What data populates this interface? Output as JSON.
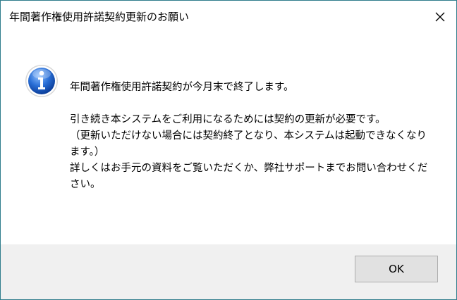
{
  "window": {
    "title": "年間著作権使用許諾契約更新のお願い",
    "icon": "information-icon"
  },
  "message": {
    "line1": "年間著作権使用許諾契約が今月末で終了します。",
    "line2": "引き続き本システムをご利用になるためには契約の更新が必要です。",
    "line3": "（更新いただけない場合には契約終了となり、本システムは起動できなくなります。）",
    "line4": "詳しくはお手元の資料をご覧いただくか、弊社サポートまでお問い合わせください。"
  },
  "buttons": {
    "ok_label": "OK"
  },
  "colors": {
    "border": "#2f7d8c",
    "footer_bg": "#f0f0f0",
    "button_bg": "#e1e1e1",
    "icon_blue": "#1f5fbf"
  }
}
